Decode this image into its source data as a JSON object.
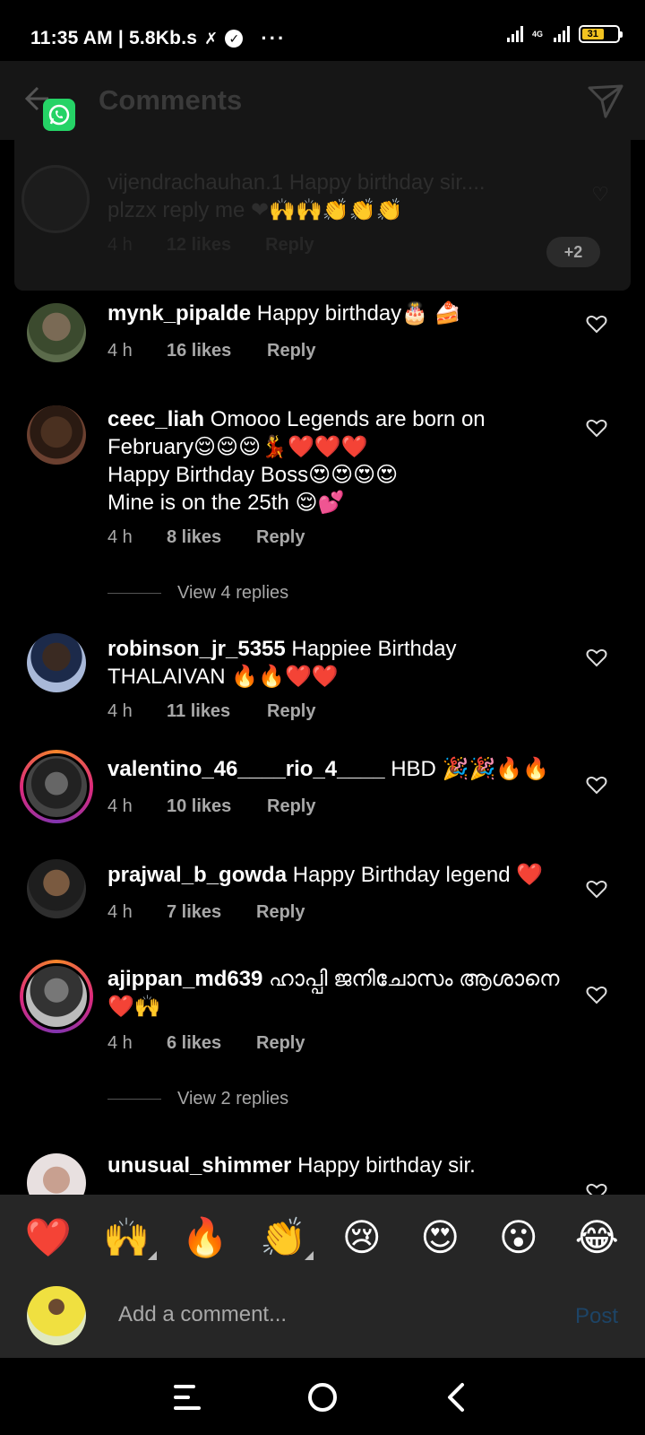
{
  "status_bar": {
    "time_speed": "11:35 AM | 5.8Kb.s",
    "more": "···",
    "network": "4G",
    "battery": "31"
  },
  "header": {
    "title": "Comments"
  },
  "overlay_comment": {
    "username": "vijendrachauhan.1",
    "text": "Happy birthday sir.... plzzx reply me ❤🙌🙌👏👏👏",
    "time": "4 h",
    "likes": "12 likes",
    "reply": "Reply",
    "badge": "+2"
  },
  "comments": [
    {
      "username": "mynk_pipalde",
      "text": "Happy birthday🎂 🍰",
      "time": "4 h",
      "likes": "16 likes",
      "reply": "Reply"
    },
    {
      "username": "ceec_liah",
      "text": "Omooo Legends are born on February😌😌😌💃❤️❤️❤️\nHappy Birthday Boss😍😍😍😍\nMine is on the 25th 😌💕",
      "time": "4 h",
      "likes": "8 likes",
      "reply": "Reply",
      "view_replies": "View 4 replies"
    },
    {
      "username": "robinson_jr_5355",
      "text": "Happiee Birthday THALAIVAN 🔥🔥❤️❤️",
      "time": "4 h",
      "likes": "11 likes",
      "reply": "Reply"
    },
    {
      "username": "valentino_46____rio_4____",
      "text": "HBD 🎉🎉🔥🔥",
      "time": "4 h",
      "likes": "10 likes",
      "reply": "Reply"
    },
    {
      "username": "prajwal_b_gowda",
      "text": "Happy Birthday legend ❤️",
      "time": "4 h",
      "likes": "7 likes",
      "reply": "Reply"
    },
    {
      "username": "ajippan_md639",
      "text": "ഹാപ്പി ജനിചോസം ആശാനെ ❤️🙌",
      "time": "4 h",
      "likes": "6 likes",
      "reply": "Reply",
      "view_replies": "View 2 replies"
    },
    {
      "username": "unusual_shimmer",
      "text": "Happy birthday sir."
    }
  ],
  "reactions": [
    "❤️",
    "🙌",
    "🔥",
    "👏",
    "😢",
    "😍",
    "😮",
    "😂"
  ],
  "composer": {
    "placeholder": "Add a comment...",
    "post": "Post"
  },
  "colors": {
    "background": "#000000",
    "panel": "#262626",
    "secondary_text": "#a8a8a8",
    "post_disabled": "#1d4466"
  }
}
